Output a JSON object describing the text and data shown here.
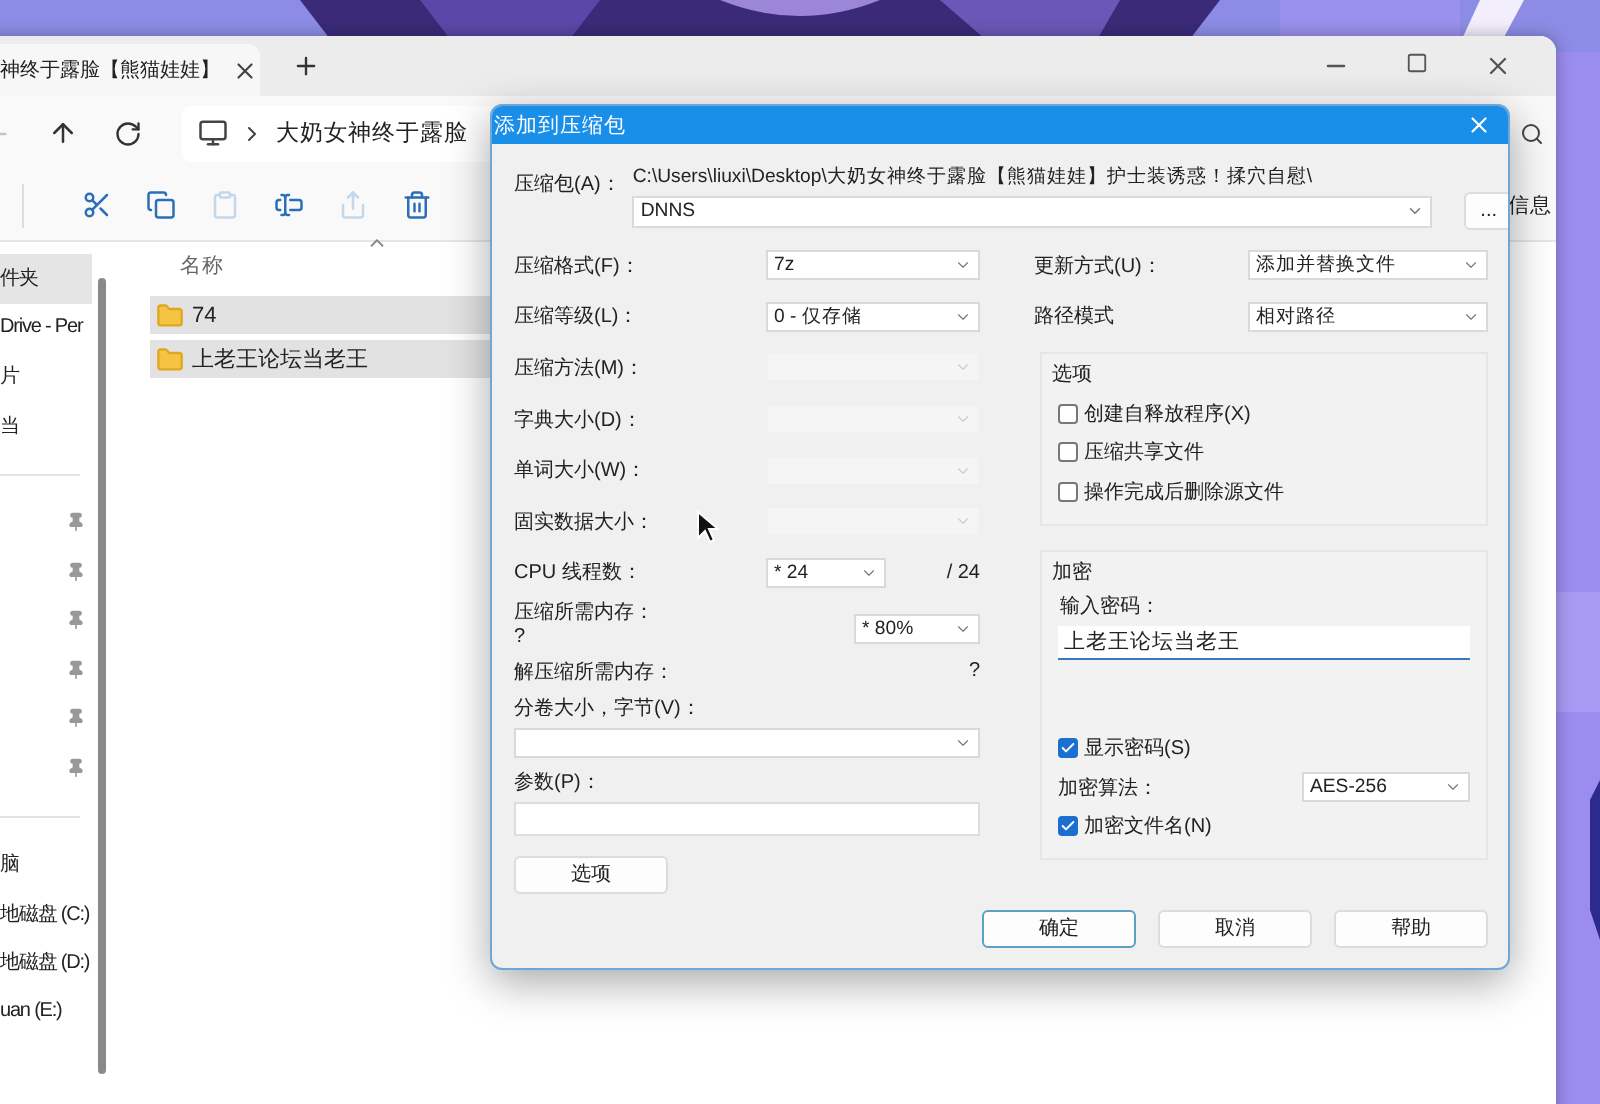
{
  "explorer": {
    "tab": {
      "title": "神终于露脸【熊猫娃娃】"
    },
    "address": {
      "segment": "大奶女神终于露脸"
    },
    "toolbar": {
      "tools": [
        {
          "kind": "cut",
          "disabled": false
        },
        {
          "kind": "copy",
          "disabled": false
        },
        {
          "kind": "paste",
          "disabled": true
        },
        {
          "kind": "rename",
          "disabled": false
        },
        {
          "kind": "share",
          "disabled": true
        },
        {
          "kind": "delete",
          "disabled": false
        }
      ],
      "info_label": "信息"
    },
    "sidebar": {
      "top": [
        {
          "label": "件夹",
          "selected": true
        },
        {
          "label": "Drive - Per",
          "selected": false
        },
        {
          "label": "片",
          "selected": false
        },
        {
          "label": "当",
          "selected": false
        }
      ],
      "quick_access": [
        {
          "pinned": true
        },
        {
          "pinned": true
        },
        {
          "pinned": true
        },
        {
          "pinned": true
        },
        {
          "pinned": true
        },
        {
          "pinned": true
        }
      ],
      "drives": [
        {
          "label": "脑",
          "selected": false
        },
        {
          "label": "地磁盘 (C:)",
          "selected": false
        },
        {
          "label": "地磁盘 (D:)",
          "selected": false
        },
        {
          "label": "uan (E:)",
          "selected": false
        }
      ]
    },
    "files": {
      "column": "名称",
      "rows": [
        {
          "name": "74",
          "selected": true
        },
        {
          "name": "上老王论坛当老王",
          "selected": true
        }
      ]
    }
  },
  "dialog": {
    "title": "添加到压缩包",
    "archive": {
      "label": "压缩包(A)：",
      "path": "C:\\Users\\liuxi\\Desktop\\大奶女神终于露脸【熊猫娃娃】护士装诱惑！揉穴自慰\\",
      "value": "DNNS",
      "browse": "..."
    },
    "left_rows": [
      {
        "kind": "select",
        "label": "压缩格式(F)：",
        "value": "7z",
        "disabled": false
      },
      {
        "kind": "select",
        "label": "压缩等级(L)：",
        "value": "0 - 仅存储",
        "disabled": false
      },
      {
        "kind": "select",
        "label": "压缩方法(M)：",
        "disabled": true
      },
      {
        "kind": "select",
        "label": "字典大小(D)：",
        "disabled": true
      },
      {
        "kind": "select",
        "label": "单词大小(W)：",
        "disabled": true
      },
      {
        "kind": "select",
        "label": "固实数据大小：",
        "disabled": true
      },
      {
        "kind": "cpu",
        "label": "CPU 线程数：",
        "value": "* 24",
        "suffix": "/ 24",
        "disabled": false
      },
      {
        "kind": "memory",
        "label": "压缩所需内存：",
        "note": "?",
        "value": "* 80%",
        "disabled": false
      },
      {
        "kind": "info",
        "label": "解压缩所需内存：",
        "note": "?"
      },
      {
        "kind": "volume",
        "label": "分卷大小，字节(V)：",
        "disabled": false
      },
      {
        "kind": "params",
        "label": "参数(P)："
      }
    ],
    "options_button": "选项",
    "update": {
      "label": "更新方式(U)：",
      "value": "添加并替换文件"
    },
    "path_mode": {
      "label": "路径模式",
      "value": "相对路径"
    },
    "options": {
      "title": "选项",
      "items": [
        {
          "label": "创建自释放程序(X)",
          "checked": false
        },
        {
          "label": "压缩共享文件",
          "checked": false
        },
        {
          "label": "操作完成后删除源文件",
          "checked": false
        }
      ]
    },
    "encryption": {
      "title": "加密",
      "password_label": "输入密码：",
      "password": "上老王论坛当老王",
      "show_password": {
        "label": "显示密码(S)",
        "checked": true
      },
      "method": {
        "label": "加密算法：",
        "value": "AES-256"
      },
      "encrypt_names": {
        "label": "加密文件名(N)",
        "checked": true
      }
    },
    "buttons": [
      {
        "label": "确定",
        "default": true
      },
      {
        "label": "取消",
        "default": false
      },
      {
        "label": "帮助",
        "default": false
      }
    ]
  }
}
